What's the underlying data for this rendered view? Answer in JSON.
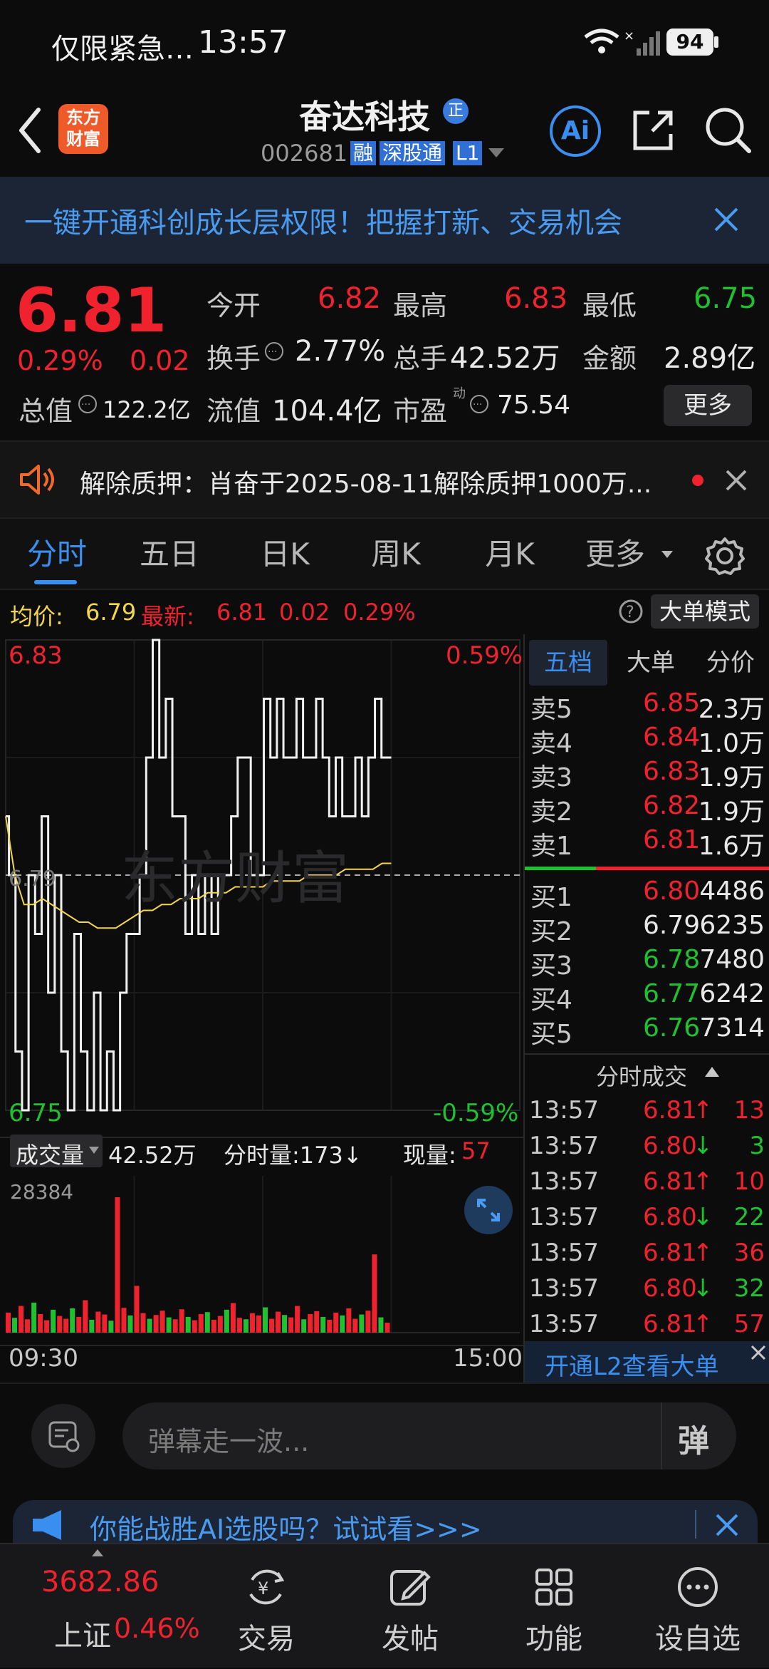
{
  "status_bar": {
    "notification": "仅限紧急…",
    "time": "13:57",
    "battery": "94"
  },
  "header": {
    "logo_text_line1": "东方",
    "logo_text_line2": "财富",
    "stock_name": "奋达科技",
    "badge_zheng": "正",
    "stock_code": "002681",
    "tag_rong": "融",
    "tag_sgt": "深股通",
    "tag_level": "L1",
    "ai_label": "Ai"
  },
  "banner": {
    "text": "一键开通科创成长层权限！把握打新、交易机会"
  },
  "quote": {
    "price": "6.81",
    "change_pct": "0.29%",
    "change_amt": "0.02",
    "open_label": "今开",
    "open_value": "6.82",
    "high_label": "最高",
    "high_value": "6.83",
    "low_label": "最低",
    "low_value": "6.75",
    "turnover_label": "换手",
    "turnover_value": "2.77%",
    "volume_label": "总手",
    "volume_value": "42.52万",
    "amount_label": "金额",
    "amount_value": "2.89亿",
    "mktcap_label": "总值",
    "mktcap_value": "122.2亿",
    "float_label": "流值",
    "float_value": "104.4亿",
    "pe_label": "市盈",
    "pe_sup": "动",
    "pe_value": "75.54",
    "more_button": "更多"
  },
  "notice": {
    "text": "解除质押：肖奋于2025-08-11解除质押1000万..."
  },
  "tabs": [
    {
      "label": "分时",
      "active": true
    },
    {
      "label": "五日",
      "active": false
    },
    {
      "label": "日K",
      "active": false
    },
    {
      "label": "周K",
      "active": false
    },
    {
      "label": "月K",
      "active": false
    },
    {
      "label": "更多",
      "active": false
    }
  ],
  "info_line": {
    "avg_label": "均价:",
    "avg_value": "6.79",
    "latest_label": "最新:",
    "latest_value": "6.81",
    "latest_chg": "0.02",
    "latest_pct": "0.29%",
    "big_order_mode": "大单模式"
  },
  "chart": {
    "y_top_label": "6.83",
    "y_top_pct": "0.59%",
    "y_mid_label": "6.79",
    "y_bottom_label": "6.75",
    "y_bottom_pct": "-0.59%",
    "watermark": "东方财富",
    "volume_selector": "成交量",
    "volume_total": "42.52万",
    "tick_volume": "分时量:173↓",
    "current_volume_label": "现量:",
    "current_volume_value": "57",
    "volume_max": "28384",
    "time_start": "09:30",
    "time_end": "15:00"
  },
  "chart_data": {
    "type": "line",
    "series": [
      {
        "name": "price",
        "values": [
          6.8,
          6.79,
          6.76,
          6.75,
          6.79,
          6.78,
          6.8,
          6.77,
          6.79,
          6.76,
          6.75,
          6.78,
          6.76,
          6.75,
          6.77,
          6.75,
          6.76,
          6.75,
          6.77,
          6.78,
          6.78,
          6.79,
          6.81,
          6.83,
          6.81,
          6.82,
          6.8,
          6.8,
          6.78,
          6.79,
          6.78,
          6.79,
          6.78,
          6.79,
          6.79,
          6.8,
          6.81,
          6.81,
          6.79,
          6.79,
          6.82,
          6.81,
          6.82,
          6.81,
          6.81,
          6.82,
          6.81,
          6.81,
          6.82,
          6.81,
          6.8,
          6.81,
          6.8,
          6.8,
          6.81,
          6.8,
          6.81,
          6.82,
          6.81,
          6.81
        ]
      },
      {
        "name": "avg",
        "values": [
          6.8,
          6.79,
          6.785,
          6.785,
          6.786,
          6.785,
          6.784,
          6.783,
          6.782,
          6.782,
          6.781,
          6.781,
          6.781,
          6.782,
          6.783,
          6.784,
          6.784,
          6.785,
          6.785,
          6.786,
          6.786,
          6.786,
          6.787,
          6.787,
          6.787,
          6.788,
          6.788,
          6.788,
          6.788,
          6.789,
          6.789,
          6.789,
          6.789,
          6.79,
          6.79,
          6.79,
          6.79,
          6.791,
          6.791,
          6.791,
          6.791,
          6.792,
          6.792
        ]
      }
    ],
    "volume": [
      4200,
      3100,
      5600,
      2800,
      6300,
      3900,
      2600,
      4800,
      3500,
      2900,
      5100,
      3300,
      6800,
      2700,
      4400,
      3800,
      2500,
      28384,
      5200,
      3600,
      9800,
      4100,
      2900,
      3700,
      4600,
      3200,
      2800,
      4900,
      3300,
      2600,
      3900,
      4300,
      2700,
      3500,
      4800,
      6200,
      3100,
      2800,
      4100,
      3600,
      5300,
      2900,
      4400,
      3700,
      3200,
      5600,
      2800,
      3900,
      4500,
      3300,
      2700,
      4200,
      3600,
      5100,
      2900,
      3800,
      4600,
      16400,
      3200,
      2100
    ],
    "ylim": [
      6.75,
      6.83
    ],
    "reference_price": 6.79
  },
  "order_book": {
    "tabs": [
      "五档",
      "大单",
      "分价"
    ],
    "asks": [
      {
        "label": "卖5",
        "price": "6.85",
        "vol": "2.3万"
      },
      {
        "label": "卖4",
        "price": "6.84",
        "vol": "1.0万"
      },
      {
        "label": "卖3",
        "price": "6.83",
        "vol": "1.9万"
      },
      {
        "label": "卖2",
        "price": "6.82",
        "vol": "1.9万"
      },
      {
        "label": "卖1",
        "price": "6.81",
        "vol": "1.6万"
      }
    ],
    "bids": [
      {
        "label": "买1",
        "price": "6.80",
        "vol": "4486"
      },
      {
        "label": "买2",
        "price": "6.79",
        "vol": "6235"
      },
      {
        "label": "买3",
        "price": "6.78",
        "vol": "7480"
      },
      {
        "label": "买4",
        "price": "6.77",
        "vol": "6242"
      },
      {
        "label": "买5",
        "price": "6.76",
        "vol": "7314"
      }
    ],
    "ticks_title": "分时成交",
    "ticks": [
      {
        "time": "13:57",
        "price": "6.81",
        "dir": "↑",
        "vol": "13"
      },
      {
        "time": "13:57",
        "price": "6.80",
        "dir": "↓",
        "vol": "3"
      },
      {
        "time": "13:57",
        "price": "6.81",
        "dir": "↑",
        "vol": "10"
      },
      {
        "time": "13:57",
        "price": "6.80",
        "dir": "↓",
        "vol": "22"
      },
      {
        "time": "13:57",
        "price": "6.81",
        "dir": "↑",
        "vol": "36"
      },
      {
        "time": "13:57",
        "price": "6.80",
        "dir": "↓",
        "vol": "32"
      },
      {
        "time": "13:57",
        "price": "6.81",
        "dir": "↑",
        "vol": "57"
      }
    ],
    "l2_promo": "开通L2查看大单"
  },
  "comment": {
    "placeholder": "弹幕走一波...",
    "danmu_label": "弹"
  },
  "ai_promo": {
    "text": "你能战胜AI选股吗？试试看>>>"
  },
  "bottom_nav": {
    "index_value": "3682.86",
    "index_name": "上证",
    "index_pct": "0.46%",
    "items": [
      "交易",
      "发帖",
      "功能",
      "设自选"
    ]
  }
}
